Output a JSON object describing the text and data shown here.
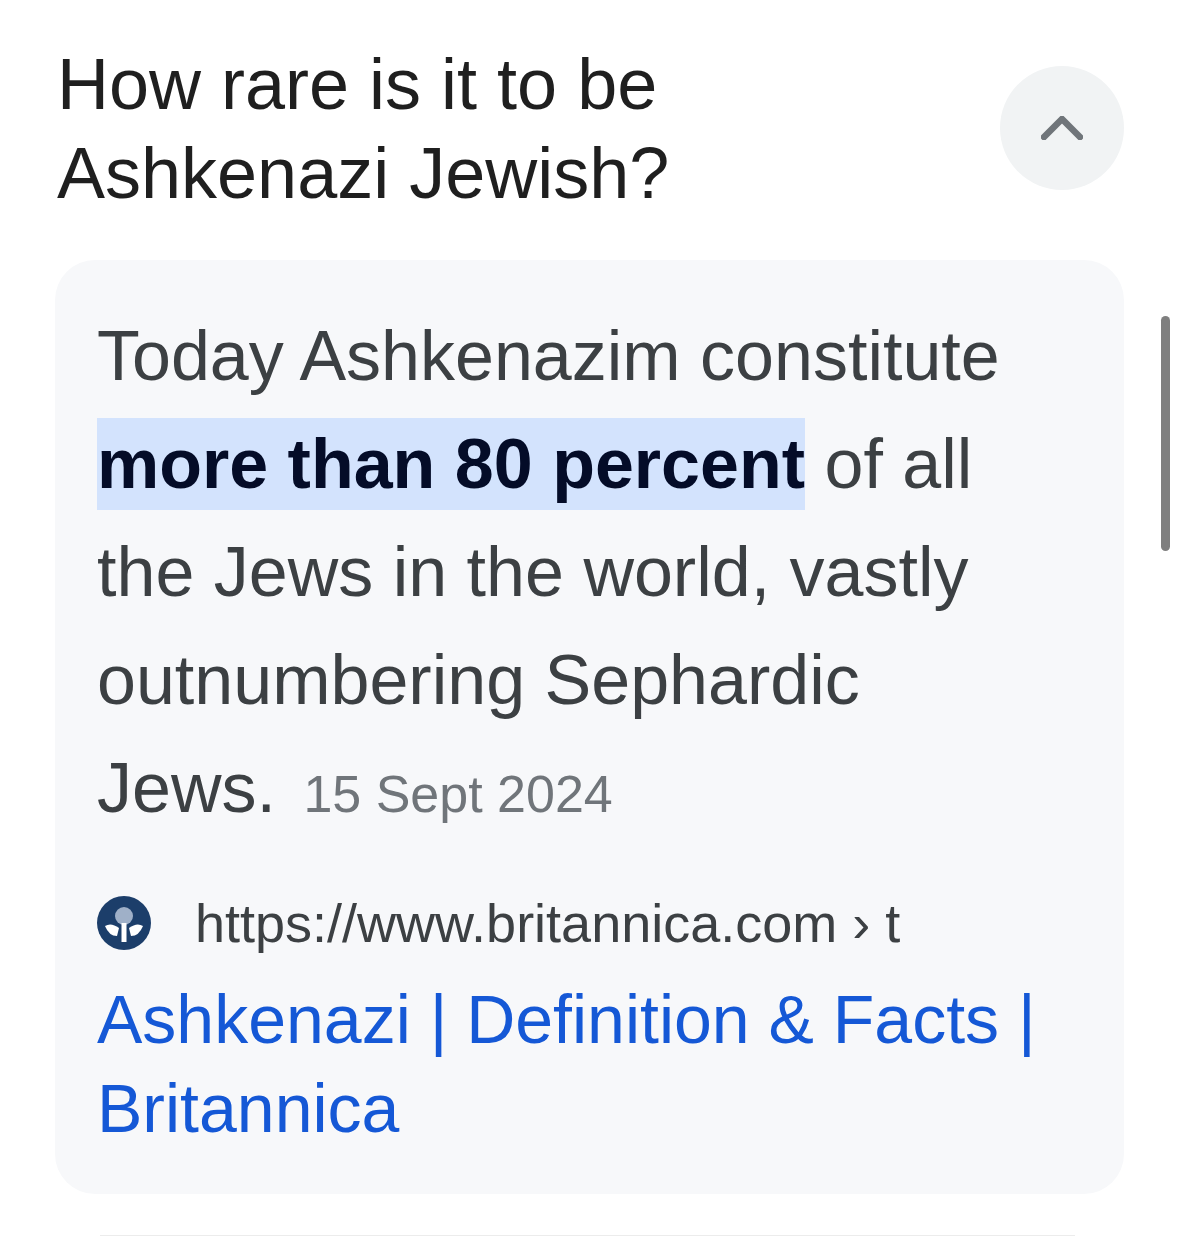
{
  "question": {
    "title": "How rare is it to be Ashkenazi Jewish?",
    "expanded": true
  },
  "answer": {
    "snippet": "Today Ashkenazim constitute **more than 80 percent** of all the Jews in the world, vastly outnumbering Sephardic Jews.",
    "date": "15 Sept 2024",
    "source": {
      "url": "https://www.britannica.com › t",
      "title": "Ashkenazi | Definition & Facts | Britannica"
    }
  }
}
